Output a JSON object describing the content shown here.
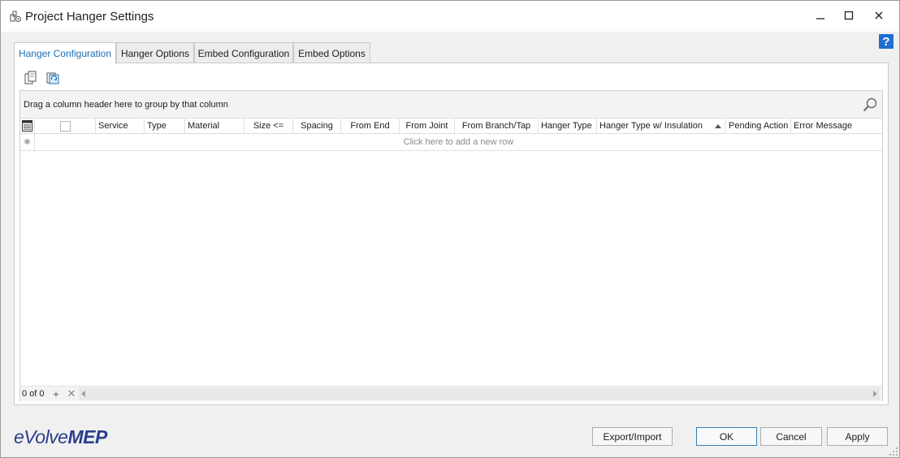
{
  "window": {
    "title": "Project Hanger Settings",
    "app_icon": "hanger-settings-icon",
    "controls": [
      "minimize-icon",
      "maximize-icon",
      "close-icon"
    ]
  },
  "help": {
    "label": "?"
  },
  "tabs": [
    {
      "label": "Hanger Configuration",
      "active": true
    },
    {
      "label": "Hanger Options",
      "active": false
    },
    {
      "label": "Embed Configuration",
      "active": false
    },
    {
      "label": "Embed Options",
      "active": false
    }
  ],
  "toolbar": {
    "icons": [
      "copy-icon",
      "refresh-copy-icon"
    ]
  },
  "grid": {
    "group_panel_text": "Drag a column header here to group by that column",
    "columns": [
      "Service",
      "Type",
      "Material",
      "Size <=",
      "Spacing",
      "From End",
      "From Joint",
      "From Branch/Tap",
      "Hanger Type",
      "Hanger Type w/ Insulation",
      "Pending Action",
      "Error Message"
    ],
    "sorted_column": "Hanger Type w/ Insulation",
    "sort_direction": "ascending",
    "new_row_text": "Click here to add a new row",
    "new_row_indicator": "❋",
    "navigator": {
      "count_text": "0 of 0",
      "add_symbol": "+",
      "delete_symbol": "✕"
    }
  },
  "footer": {
    "logo_light": "eVolve",
    "logo_bold": "MEP",
    "buttons": {
      "export_import": "Export/Import",
      "ok": "OK",
      "cancel": "Cancel",
      "apply": "Apply"
    }
  },
  "colors": {
    "accent": "#1a6fb5",
    "logo": "#2b3f8f",
    "help": "#1e6fcf"
  }
}
